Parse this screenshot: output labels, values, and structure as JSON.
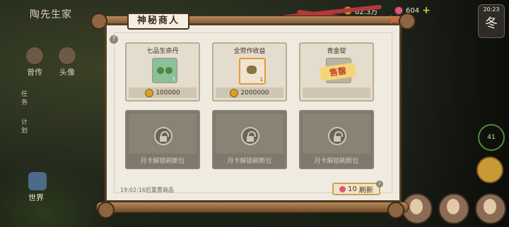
{
  "game": {
    "title": "陶先生家"
  },
  "hud": {
    "coins": "62.3万",
    "gems": "604",
    "time": "20:23",
    "season": "冬",
    "ring_value": "41"
  },
  "left_menu": {
    "btn1": "曾传",
    "btn2": "头像",
    "vertical1": "任务",
    "vertical2": "计划",
    "world": "世界"
  },
  "shop": {
    "title": "神秘商人",
    "items": [
      {
        "name": "七品生命丹",
        "price": "100000",
        "count": "1"
      },
      {
        "name": "全劳作收益",
        "price": "2000000",
        "count": "1"
      },
      {
        "name": "青金锭",
        "sold_label": "售罄"
      }
    ],
    "locked_label": "月卡解锁刷新位",
    "reset_text": "19:02:16后重置商品",
    "refresh": {
      "cost": "10",
      "label": "刷新"
    }
  }
}
